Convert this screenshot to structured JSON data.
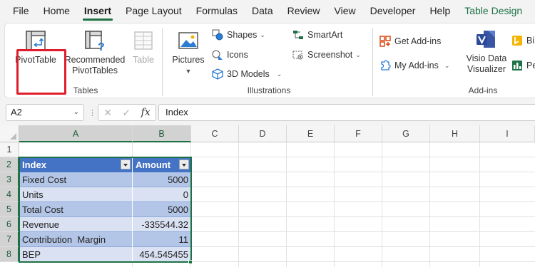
{
  "ribbon_tabs": [
    "File",
    "Home",
    "Insert",
    "Page Layout",
    "Formulas",
    "Data",
    "Review",
    "View",
    "Developer",
    "Help",
    "Table Design"
  ],
  "active_tab": "Insert",
  "groups": {
    "tables": {
      "label": "Tables",
      "pivot_table": "PivotTable",
      "recommended_line1": "Recommended",
      "recommended_line2": "PivotTables",
      "table": "Table"
    },
    "illustrations": {
      "label": "Illustrations",
      "pictures": "Pictures",
      "shapes": "Shapes",
      "icons": "Icons",
      "models_3d": "3D Models",
      "smartart": "SmartArt",
      "screenshot": "Screenshot"
    },
    "addins": {
      "label": "Add-ins",
      "get_addins": "Get Add-ins",
      "my_addins": "My Add-ins",
      "visio_line1": "Visio Data",
      "visio_line2": "Visualizer",
      "bing_partial": "Bi",
      "people_partial": "Pe"
    }
  },
  "colors": {
    "excel_green": "#1e7145",
    "table_header": "#4472c4",
    "band_dark": "#b4c6e7",
    "band_light": "#d9e1f2",
    "highlight_red": "#e01e2b"
  },
  "formula_bar": {
    "name_box": "A2",
    "fx": "fx",
    "content": "Index"
  },
  "columns": [
    "A",
    "B",
    "C",
    "D",
    "E",
    "F",
    "G",
    "H",
    "I"
  ],
  "rows": [
    "1",
    "2",
    "3",
    "4",
    "5",
    "6",
    "7",
    "8"
  ],
  "table": {
    "headers": [
      "Index",
      "Amount"
    ],
    "rows": [
      [
        "Fixed Cost",
        "5000"
      ],
      [
        "Units",
        "0"
      ],
      [
        "Total Cost",
        "5000"
      ],
      [
        "Revenue",
        "-335544.32"
      ],
      [
        "Contribution  Margin",
        "11"
      ],
      [
        "BEP",
        "454.545455"
      ]
    ]
  }
}
